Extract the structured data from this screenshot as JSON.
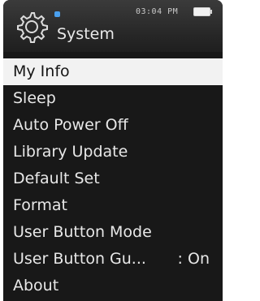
{
  "header": {
    "title": "System",
    "clock": "03:04 PM",
    "icon": "gear-icon",
    "battery_level": 1.0
  },
  "menu": {
    "selected_index": 0,
    "items": [
      {
        "label": "My Info"
      },
      {
        "label": "Sleep"
      },
      {
        "label": "Auto Power Off"
      },
      {
        "label": "Library Update"
      },
      {
        "label": "Default Set"
      },
      {
        "label": "Format"
      },
      {
        "label": "User Button Mode"
      },
      {
        "label": "User Button Gu...",
        "value": ": On"
      },
      {
        "label": "About"
      }
    ]
  },
  "colors": {
    "background": "#181818",
    "header": "#2e2e2e",
    "selected_bg": "#f2f2f2",
    "selected_text": "#151515",
    "text": "#e8e8e8",
    "status_dot": "#4aa0ee"
  }
}
